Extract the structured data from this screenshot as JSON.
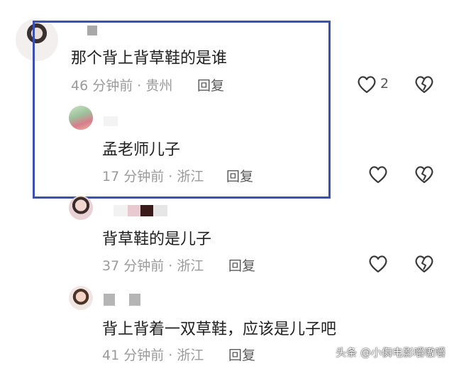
{
  "comments": [
    {
      "text": "那个背上背草鞋的是谁",
      "meta": "46 分钟前 · 贵州",
      "reply_label": "回复",
      "like_count": "2",
      "replies": [
        {
          "text": "孟老师儿子",
          "meta": "17 分钟前 · 浙江",
          "reply_label": "回复"
        }
      ]
    },
    {
      "text": "背草鞋的是儿子",
      "meta": "37 分钟前 · 浙江",
      "reply_label": "回复"
    },
    {
      "text": "背上背着一双草鞋，应该是儿子吧",
      "meta": "41 分钟前 · 浙江",
      "reply_label": "回复"
    }
  ],
  "icons": {
    "like": "heart-outline-icon",
    "dislike": "broken-heart-icon"
  },
  "colors": {
    "highlight_border": "#3b4fb5",
    "meta_text": "#9a9a9a"
  },
  "watermark": "头条 @小儛电影嚼嗷嚼"
}
